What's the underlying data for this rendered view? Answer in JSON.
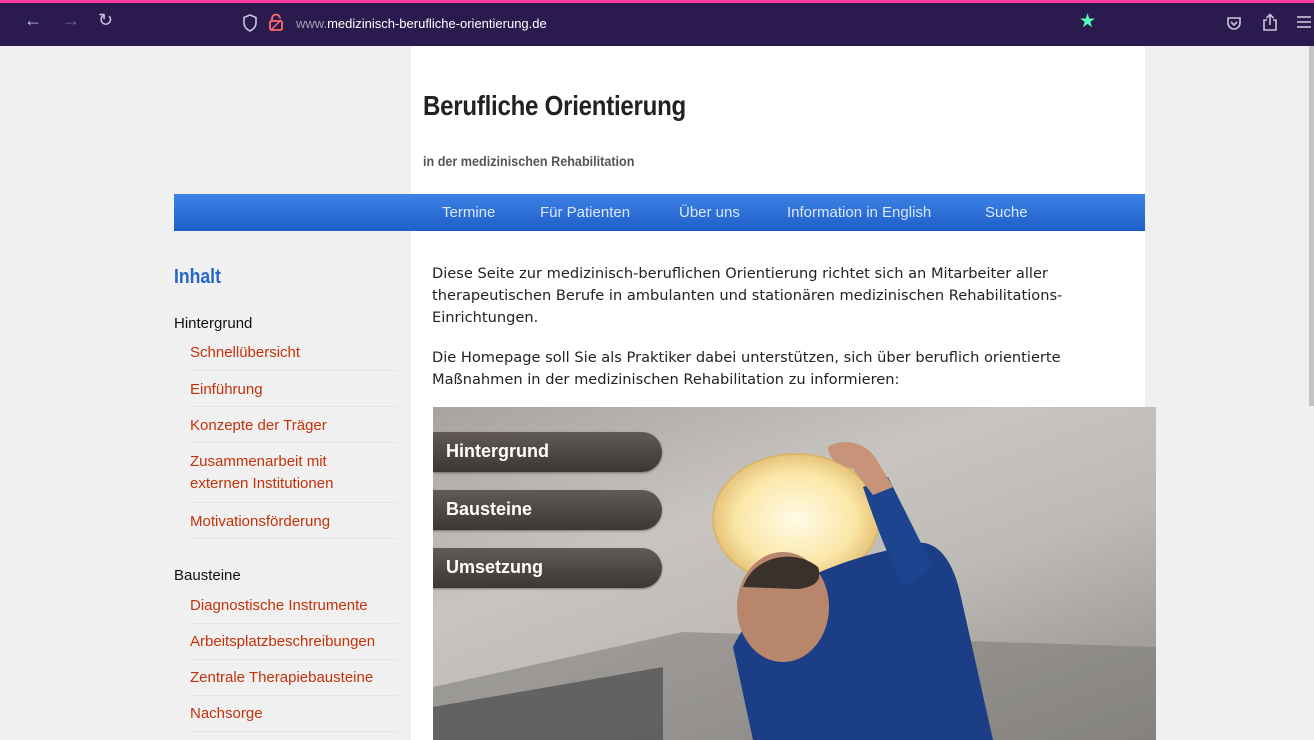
{
  "browser": {
    "url_prefix": "www.",
    "url_domain": "medizinisch-berufliche-orientierung.de",
    "icons": [
      "back-arrow-icon",
      "forward-arrow-icon",
      "reload-icon",
      "shield-icon",
      "lock-icon",
      "bookmark-star-icon",
      "pocket-icon",
      "share-icon",
      "menu-icon"
    ]
  },
  "site": {
    "title": "Berufliche Orientierung",
    "subtitle": "in der medizinischen Rehabilitation"
  },
  "nav": {
    "items": [
      {
        "label": "Termine"
      },
      {
        "label": "Für Patienten"
      },
      {
        "label": "Über uns"
      },
      {
        "label": "Information in English"
      },
      {
        "label": "Suche"
      }
    ]
  },
  "sidebar": {
    "heading": "Inhalt",
    "sections": [
      {
        "title": "Hintergrund",
        "links": [
          {
            "label": "Schnellübersicht"
          },
          {
            "label": "Einführung"
          },
          {
            "label": "Konzepte der Träger"
          },
          {
            "label": "Zusammenarbeit mit",
            "label2": "externen Institutionen"
          },
          {
            "label": "Motivationsförderung"
          }
        ]
      },
      {
        "title": "Bausteine",
        "links": [
          {
            "label": "Diagnostische Instrumente"
          },
          {
            "label": "Arbeitsplatzbeschreibungen"
          },
          {
            "label": "Zentrale Therapiebausteine"
          },
          {
            "label": "Nachsorge"
          }
        ]
      }
    ]
  },
  "content": {
    "para1_line1": "Diese Seite zur medizinisch-beruflichen Orientierung richtet sich an Mitarbeiter aller",
    "para1_line2": "therapeutischen Berufe in ambulanten und stationären medizinischen Rehabilitations-",
    "para1_line3": "Einrichtungen.",
    "para2_line1": "Die Homepage soll Sie als Praktiker dabei unterstützen, sich über beruflich orientierte",
    "para2_line2": "Maßnahmen in der medizinischen Rehabilitation zu informieren:"
  },
  "photo_menu": [
    {
      "label": "Hintergrund"
    },
    {
      "label": "Bausteine"
    },
    {
      "label": "Umsetzung"
    }
  ]
}
